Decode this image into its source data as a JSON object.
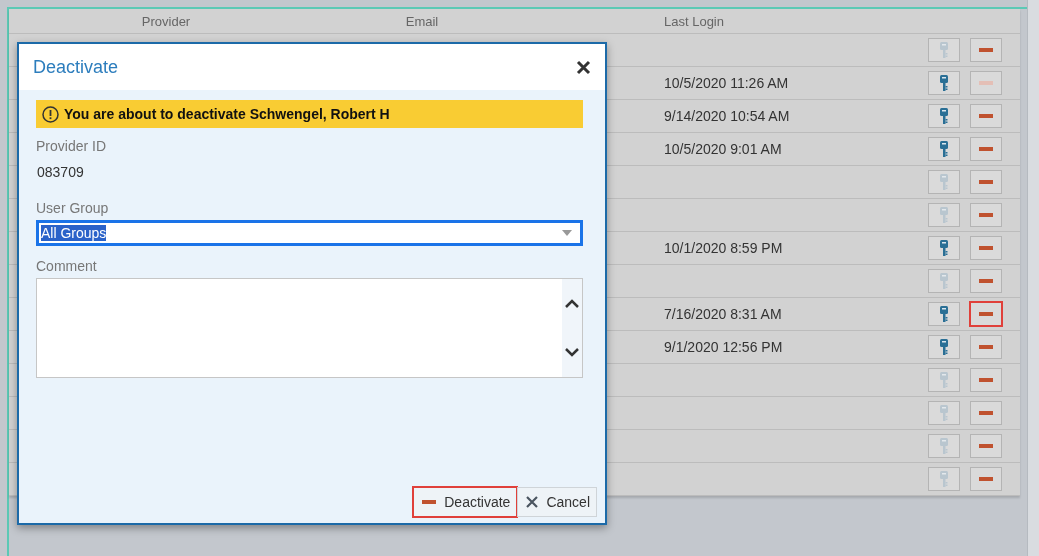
{
  "table": {
    "columns": [
      "Provider",
      "Email",
      "Last Login"
    ],
    "rows": [
      {
        "key_enabled": false,
        "deactivate_enabled": true,
        "highlighted": false
      },
      {
        "last_login": "10/5/2020 11:26 AM",
        "key_enabled": true,
        "deactivate_enabled": false,
        "highlighted": false
      },
      {
        "last_login": "9/14/2020 10:54 AM",
        "key_enabled": true,
        "deactivate_enabled": true,
        "highlighted": false
      },
      {
        "last_login": "10/5/2020 9:01 AM",
        "key_enabled": true,
        "deactivate_enabled": true,
        "highlighted": false
      },
      {
        "key_enabled": false,
        "deactivate_enabled": true,
        "highlighted": false
      },
      {
        "key_enabled": false,
        "deactivate_enabled": true,
        "highlighted": false
      },
      {
        "last_login": "10/1/2020 8:59 PM",
        "key_enabled": true,
        "deactivate_enabled": true,
        "highlighted": false
      },
      {
        "key_enabled": false,
        "deactivate_enabled": true,
        "highlighted": false
      },
      {
        "last_login": "7/16/2020 8:31 AM",
        "key_enabled": true,
        "deactivate_enabled": true,
        "highlighted": true
      },
      {
        "last_login": "9/1/2020 12:56 PM",
        "key_enabled": true,
        "deactivate_enabled": true,
        "highlighted": false
      },
      {
        "key_enabled": false,
        "deactivate_enabled": true,
        "highlighted": false
      },
      {
        "key_enabled": false,
        "deactivate_enabled": true,
        "highlighted": false
      },
      {
        "key_enabled": false,
        "deactivate_enabled": true,
        "highlighted": false
      },
      {
        "key_enabled": false,
        "deactivate_enabled": true,
        "highlighted": false
      }
    ]
  },
  "dialog": {
    "title": "Deactivate",
    "warning": "You are about to deactivate Schwengel, Robert H",
    "provider_id": {
      "label": "Provider ID",
      "value": "083709"
    },
    "user_group": {
      "label": "User Group",
      "value": "All Groups",
      "text_selected": true
    },
    "comment": {
      "label": "Comment"
    },
    "buttons": [
      {
        "kind": "deactivate",
        "label": "Deactivate",
        "highlighted": true
      },
      {
        "kind": "cancel",
        "label": "Cancel",
        "highlighted": false
      }
    ]
  }
}
